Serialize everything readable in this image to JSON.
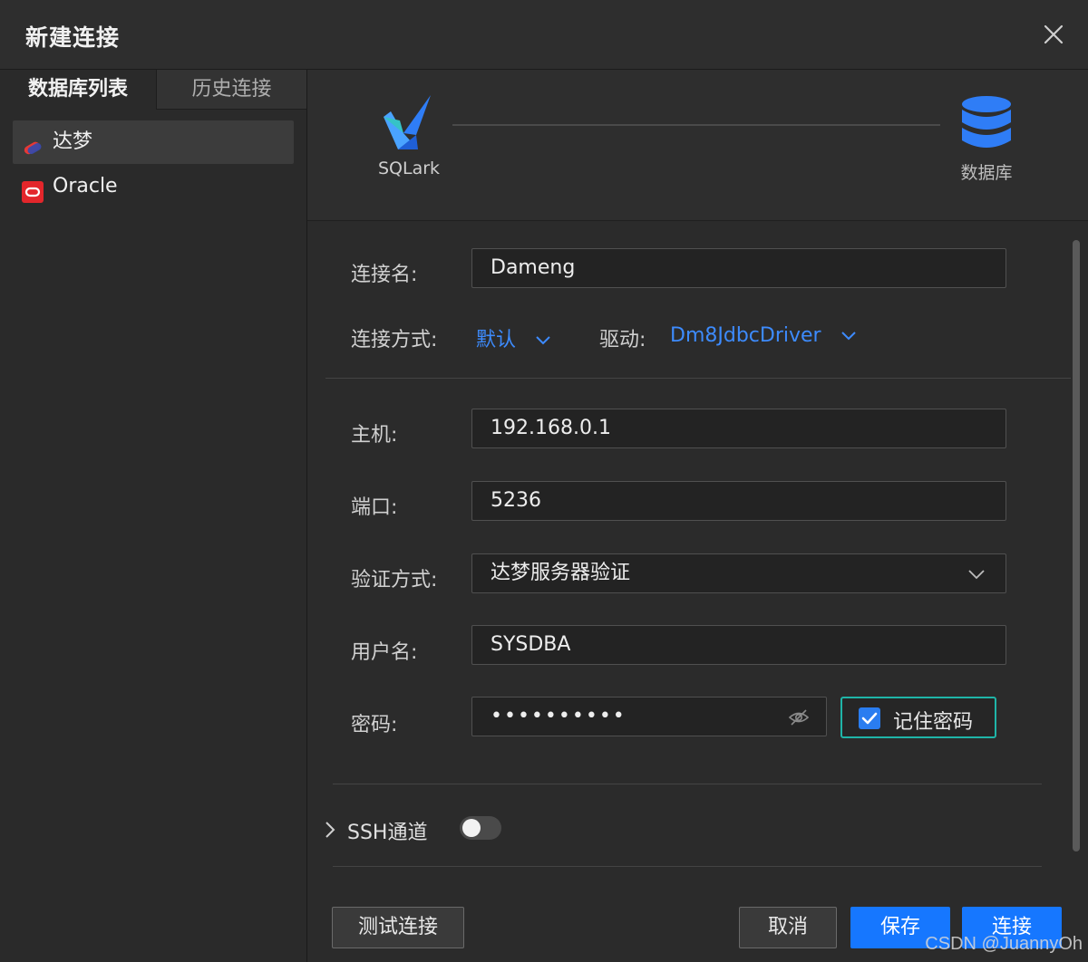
{
  "window": {
    "title": "新建连接",
    "close_icon": "close-icon"
  },
  "sidebar": {
    "tabs": [
      {
        "label": "数据库列表"
      },
      {
        "label": "历史连接"
      }
    ],
    "items": [
      {
        "label": "达梦",
        "icon": "dameng-icon"
      },
      {
        "label": "Oracle",
        "icon": "oracle-icon"
      }
    ]
  },
  "header": {
    "left_label": "SQLark",
    "right_label": "数据库"
  },
  "form": {
    "conn_name": {
      "label": "连接名:",
      "value": "Dameng"
    },
    "conn_method": {
      "label": "连接方式:",
      "value": "默认"
    },
    "driver": {
      "label": "驱动:",
      "value": "Dm8JdbcDriver"
    },
    "host": {
      "label": "主机:",
      "value": "192.168.0.1"
    },
    "port": {
      "label": "端口:",
      "value": "5236"
    },
    "auth": {
      "label": "验证方式:",
      "value": "达梦服务器验证"
    },
    "username": {
      "label": "用户名:",
      "value": "SYSDBA"
    },
    "password": {
      "label": "密码:",
      "value": "••••••••••"
    },
    "remember": {
      "label": "记住密码",
      "checked": true
    }
  },
  "ssh": {
    "label": "SSH通道",
    "enabled": false
  },
  "buttons": {
    "test": "测试连接",
    "cancel": "取消",
    "save": "保存",
    "connect": "连接"
  },
  "watermark": "CSDN @JuannyOh",
  "colors": {
    "accent": "#1677ff",
    "link": "#3d8bfd",
    "focus": "#1fb5a8"
  }
}
